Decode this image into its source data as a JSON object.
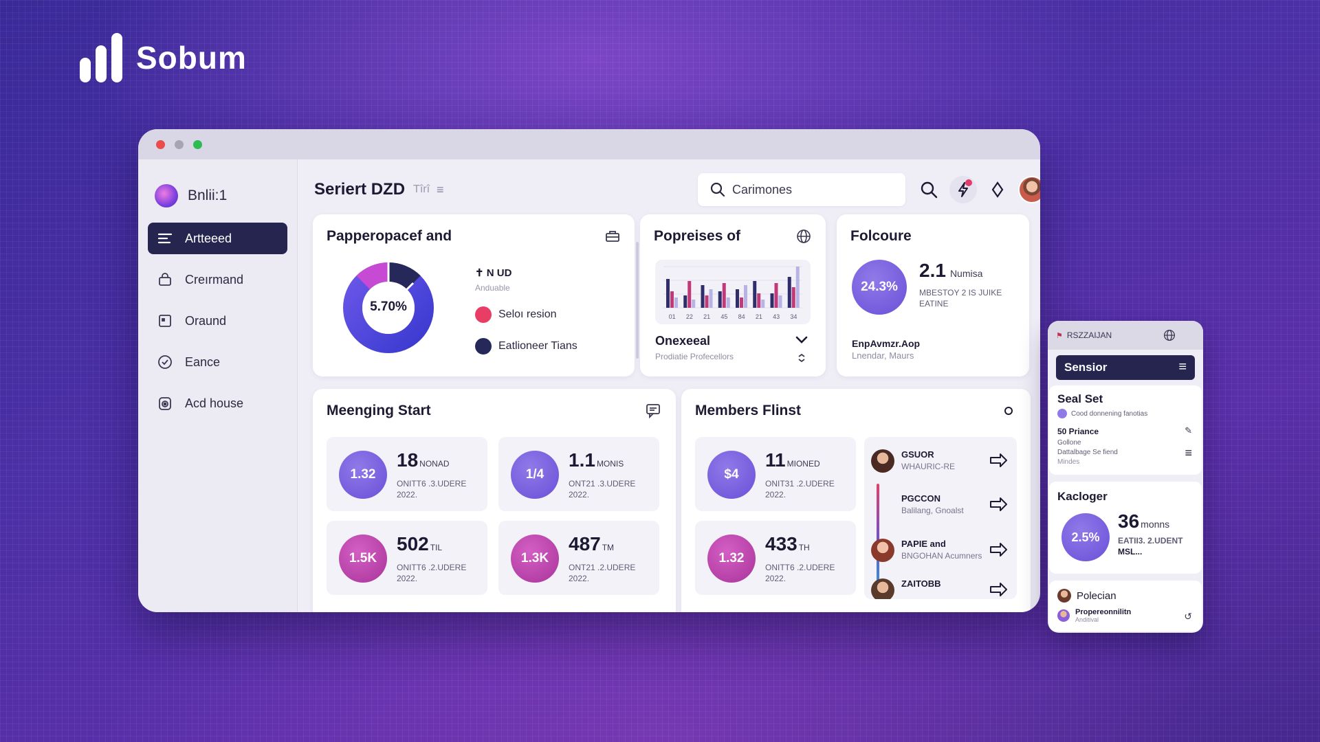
{
  "brand": {
    "name": "Sobum"
  },
  "sidebar": {
    "workspace": "Bnlii:1",
    "items": [
      {
        "label": "Artteeed",
        "icon": "list-icon",
        "active": true
      },
      {
        "label": "Creırmand",
        "icon": "bag-icon",
        "active": false
      },
      {
        "label": "Oraund",
        "icon": "square-icon",
        "active": false
      },
      {
        "label": "Eance",
        "icon": "check-circle-icon",
        "active": false
      },
      {
        "label": "Acd house",
        "icon": "camera-icon",
        "active": false
      }
    ]
  },
  "header": {
    "title": "Seriert DZD",
    "subtitle": "Tîrî",
    "search_value": "Carimones"
  },
  "card_donut": {
    "title": "Papperopacef and",
    "center_value": "5.70%",
    "legend_head": "✝ N UD",
    "legend_sub": "Anduable",
    "legend": [
      {
        "label": "Seloı resion",
        "color": "#e83e66"
      },
      {
        "label": "Eatlioneer Tians",
        "color": "#27285a"
      }
    ]
  },
  "card_bars": {
    "title": "Popreises of",
    "x_labels": [
      "01",
      "22",
      "21",
      "45",
      "84",
      "21",
      "43",
      "34"
    ],
    "dropdown_title": "Onexeeal",
    "dropdown_sub": "Prodiatie Profecellors"
  },
  "chart_data": {
    "type": "bar",
    "categories": [
      "01",
      "22",
      "21",
      "45",
      "84",
      "21",
      "43",
      "34"
    ],
    "series": [
      {
        "values": [
          28,
          12,
          22,
          16,
          18,
          26,
          14,
          30
        ]
      },
      {
        "values": [
          16,
          26,
          12,
          24,
          10,
          14,
          24,
          20
        ]
      },
      {
        "values": [
          10,
          8,
          18,
          10,
          22,
          8,
          12,
          40
        ]
      }
    ]
  },
  "card_focus": {
    "title": "Folcoure",
    "circle_value": "24.3%",
    "value": "2.1",
    "value_unit": "Numisa",
    "desc_1": "MBESTOY 2 IS JUIKE",
    "desc_2": "EATINE",
    "footer_title": "EnpAvmzr.Aop",
    "footer_sub": "Lnendar, Maurs"
  },
  "card_meeting": {
    "title": "Meenging Start",
    "tiles": [
      {
        "badge": "1.32",
        "value": "18",
        "unit": "NONAD",
        "desc": "ONITT6 .3.UDERE 2022.",
        "tone": "purple"
      },
      {
        "badge": "1/4",
        "value": "1.1",
        "unit": "MONIS",
        "desc": "ONT21 .3.UDERE 2022.",
        "tone": "purple"
      },
      {
        "badge": "1.5K",
        "value": "502",
        "unit": "TIL",
        "desc": "ONITT6 .2.UDERE 2022.",
        "tone": "magenta"
      },
      {
        "badge": "1.3K",
        "value": "487",
        "unit": "TM",
        "desc": "ONT21 .2.UDERE 2022.",
        "tone": "magenta"
      }
    ]
  },
  "card_members": {
    "title": "Members Flinst",
    "tiles": [
      {
        "badge": "$4",
        "value": "11",
        "unit": "MIONED",
        "desc": "ONIT31 .2.UDERE 2022.",
        "tone": "purple"
      },
      {
        "badge": "1.32",
        "value": "433",
        "unit": "TH",
        "desc": "ONITT6 .2.UDERE 2022.",
        "tone": "magenta"
      }
    ],
    "members": [
      {
        "name": "GSUOR",
        "sub": "WHAURIC-RE"
      },
      {
        "name": "PGCCON",
        "sub": "Balilang, Gnoalst"
      },
      {
        "name": "PAPIE and",
        "sub": "BNGOHAN Acumners"
      },
      {
        "name": "ZAITOBB",
        "sub": ""
      }
    ]
  },
  "float_panel": {
    "header": "RSZZAIJAN",
    "bar_title": "Sensior",
    "seal_title": "Seal Set",
    "seal_sub": "Cood donnening fanotias",
    "seal_item_title": "50 Priance",
    "seal_item_sub_1": "Gollone",
    "seal_item_sub_2": "Dattalbage Se fiend",
    "seal_item_sub_3": "Mindes",
    "kac_title": "Kacloger",
    "kac_circle": "2.5%",
    "kac_value": "36",
    "kac_unit": "monns",
    "kac_desc_1": "EATII3. 2.UDENT",
    "kac_desc_2": "MSL...",
    "bottom_title": "Polecian",
    "bottom_item": "Propereonnilitn",
    "bottom_item_sub": "Anditival"
  },
  "colors": {
    "navy": "#252550",
    "purple": "#6a4fd8",
    "magenta": "#c040a8",
    "pink": "#e83e66"
  }
}
